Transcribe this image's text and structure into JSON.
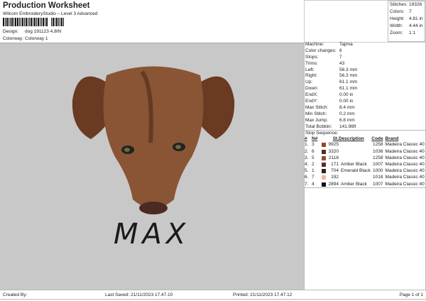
{
  "header": {
    "title": "Production Worksheet",
    "subtitle": "Wilcom EmbroideryStudio – Level 3 Advanced",
    "design_label": "Design:",
    "design": "dog 191123 4,8IN",
    "colorway_label": "Colorway:",
    "colorway": "Colorway 1"
  },
  "stats": [
    {
      "k": "Stitches:",
      "v": "19326"
    },
    {
      "k": "Colors:",
      "v": "7"
    },
    {
      "k": "Height:",
      "v": "4.81 in"
    },
    {
      "k": "Width:",
      "v": "4.44 in"
    },
    {
      "k": "Zoom:",
      "v": "1:1"
    }
  ],
  "info": [
    {
      "k": "Machine:",
      "v": "Tajima"
    },
    {
      "k": "Color changes:",
      "v": "6"
    },
    {
      "k": "Stops:",
      "v": "7"
    },
    {
      "k": "Trims:",
      "v": "43"
    },
    {
      "k": "Left:",
      "v": "56.3 mm"
    },
    {
      "k": "Right:",
      "v": "56.3 mm"
    },
    {
      "k": "Up:",
      "v": "61.1 mm"
    },
    {
      "k": "Down:",
      "v": "61.1 mm"
    },
    {
      "k": "EndX:",
      "v": "0.00 in"
    },
    {
      "k": "EndY:",
      "v": "0.00 in"
    },
    {
      "k": "Max Stitch:",
      "v": "8.4 mm"
    },
    {
      "k": "Min Stitch:",
      "v": "0.2 mm"
    },
    {
      "k": "Max Jump:",
      "v": "6.8 mm"
    },
    {
      "k": "Total Bobbin:",
      "v": "141.96ft"
    }
  ],
  "stop_sequence": {
    "label": "Stop Sequence:",
    "headers": [
      "#",
      "N#",
      "St.",
      "Description",
      "Code",
      "Brand"
    ],
    "rows": [
      {
        "n": "1.",
        "nn": "3",
        "color": "#8c4a2c",
        "st": "9925",
        "desc": "",
        "code": "1258",
        "brand": "Madeira Classic 40"
      },
      {
        "n": "2.",
        "nn": "6",
        "color": "#5c2a2c",
        "st": "3320",
        "desc": "",
        "code": "1036",
        "brand": "Madeira Classic 40"
      },
      {
        "n": "3.",
        "nn": "5",
        "color": "#8a5232",
        "st": "2118",
        "desc": "",
        "code": "1258",
        "brand": "Madeira Classic 40"
      },
      {
        "n": "4.",
        "nn": "2",
        "color": "#5a2c2c",
        "st": "171",
        "desc": "Amber Black",
        "code": "1007",
        "brand": "Madeira Classic 40"
      },
      {
        "n": "5.",
        "nn": "1",
        "color": "#252525",
        "st": "704",
        "desc": "Emerald Black",
        "code": "1000",
        "brand": "Madeira Classic 40"
      },
      {
        "n": "6.",
        "nn": "7",
        "color": "#f2b4a6",
        "st": "192",
        "desc": "",
        "code": "1018",
        "brand": "Madeira Classic 40"
      },
      {
        "n": "7.",
        "nn": "4",
        "color": "#111111",
        "st": "2894",
        "desc": "Amber Black",
        "code": "1007",
        "brand": "Madeira Classic 40"
      }
    ]
  },
  "design_text": "MAX",
  "footer": {
    "created": "Created By:",
    "saved": "Last Saved: 21/11/2023 17.47.10",
    "printed": "Printed: 21/11/2023 17.47.12",
    "page": "Page 1 of 1"
  }
}
